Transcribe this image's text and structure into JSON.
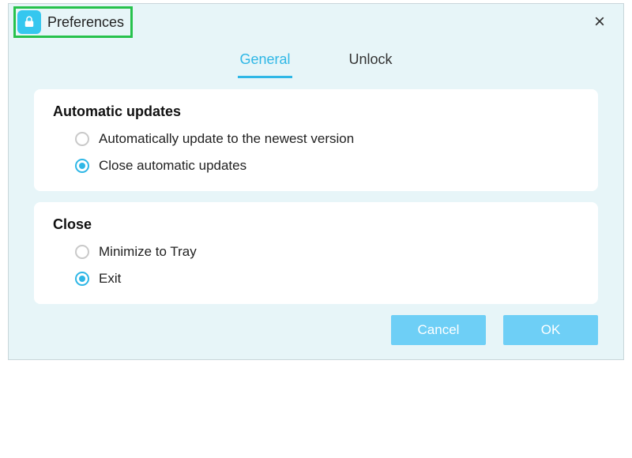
{
  "window": {
    "title": "Preferences",
    "close_icon": "×"
  },
  "tabs": [
    {
      "label": "General",
      "active": true
    },
    {
      "label": "Unlock",
      "active": false
    }
  ],
  "sections": {
    "updates": {
      "heading": "Automatic updates",
      "options": [
        {
          "label": "Automatically update to the newest version",
          "selected": false
        },
        {
          "label": "Close automatic updates",
          "selected": true
        }
      ]
    },
    "close": {
      "heading": "Close",
      "options": [
        {
          "label": "Minimize to Tray",
          "selected": false
        },
        {
          "label": "Exit",
          "selected": true
        }
      ]
    }
  },
  "buttons": {
    "cancel": "Cancel",
    "ok": "OK"
  },
  "colors": {
    "accent": "#2fb7e6",
    "button": "#6ecff6",
    "highlight_border": "#27c24c",
    "panel_bg": "#e7f5f8"
  }
}
